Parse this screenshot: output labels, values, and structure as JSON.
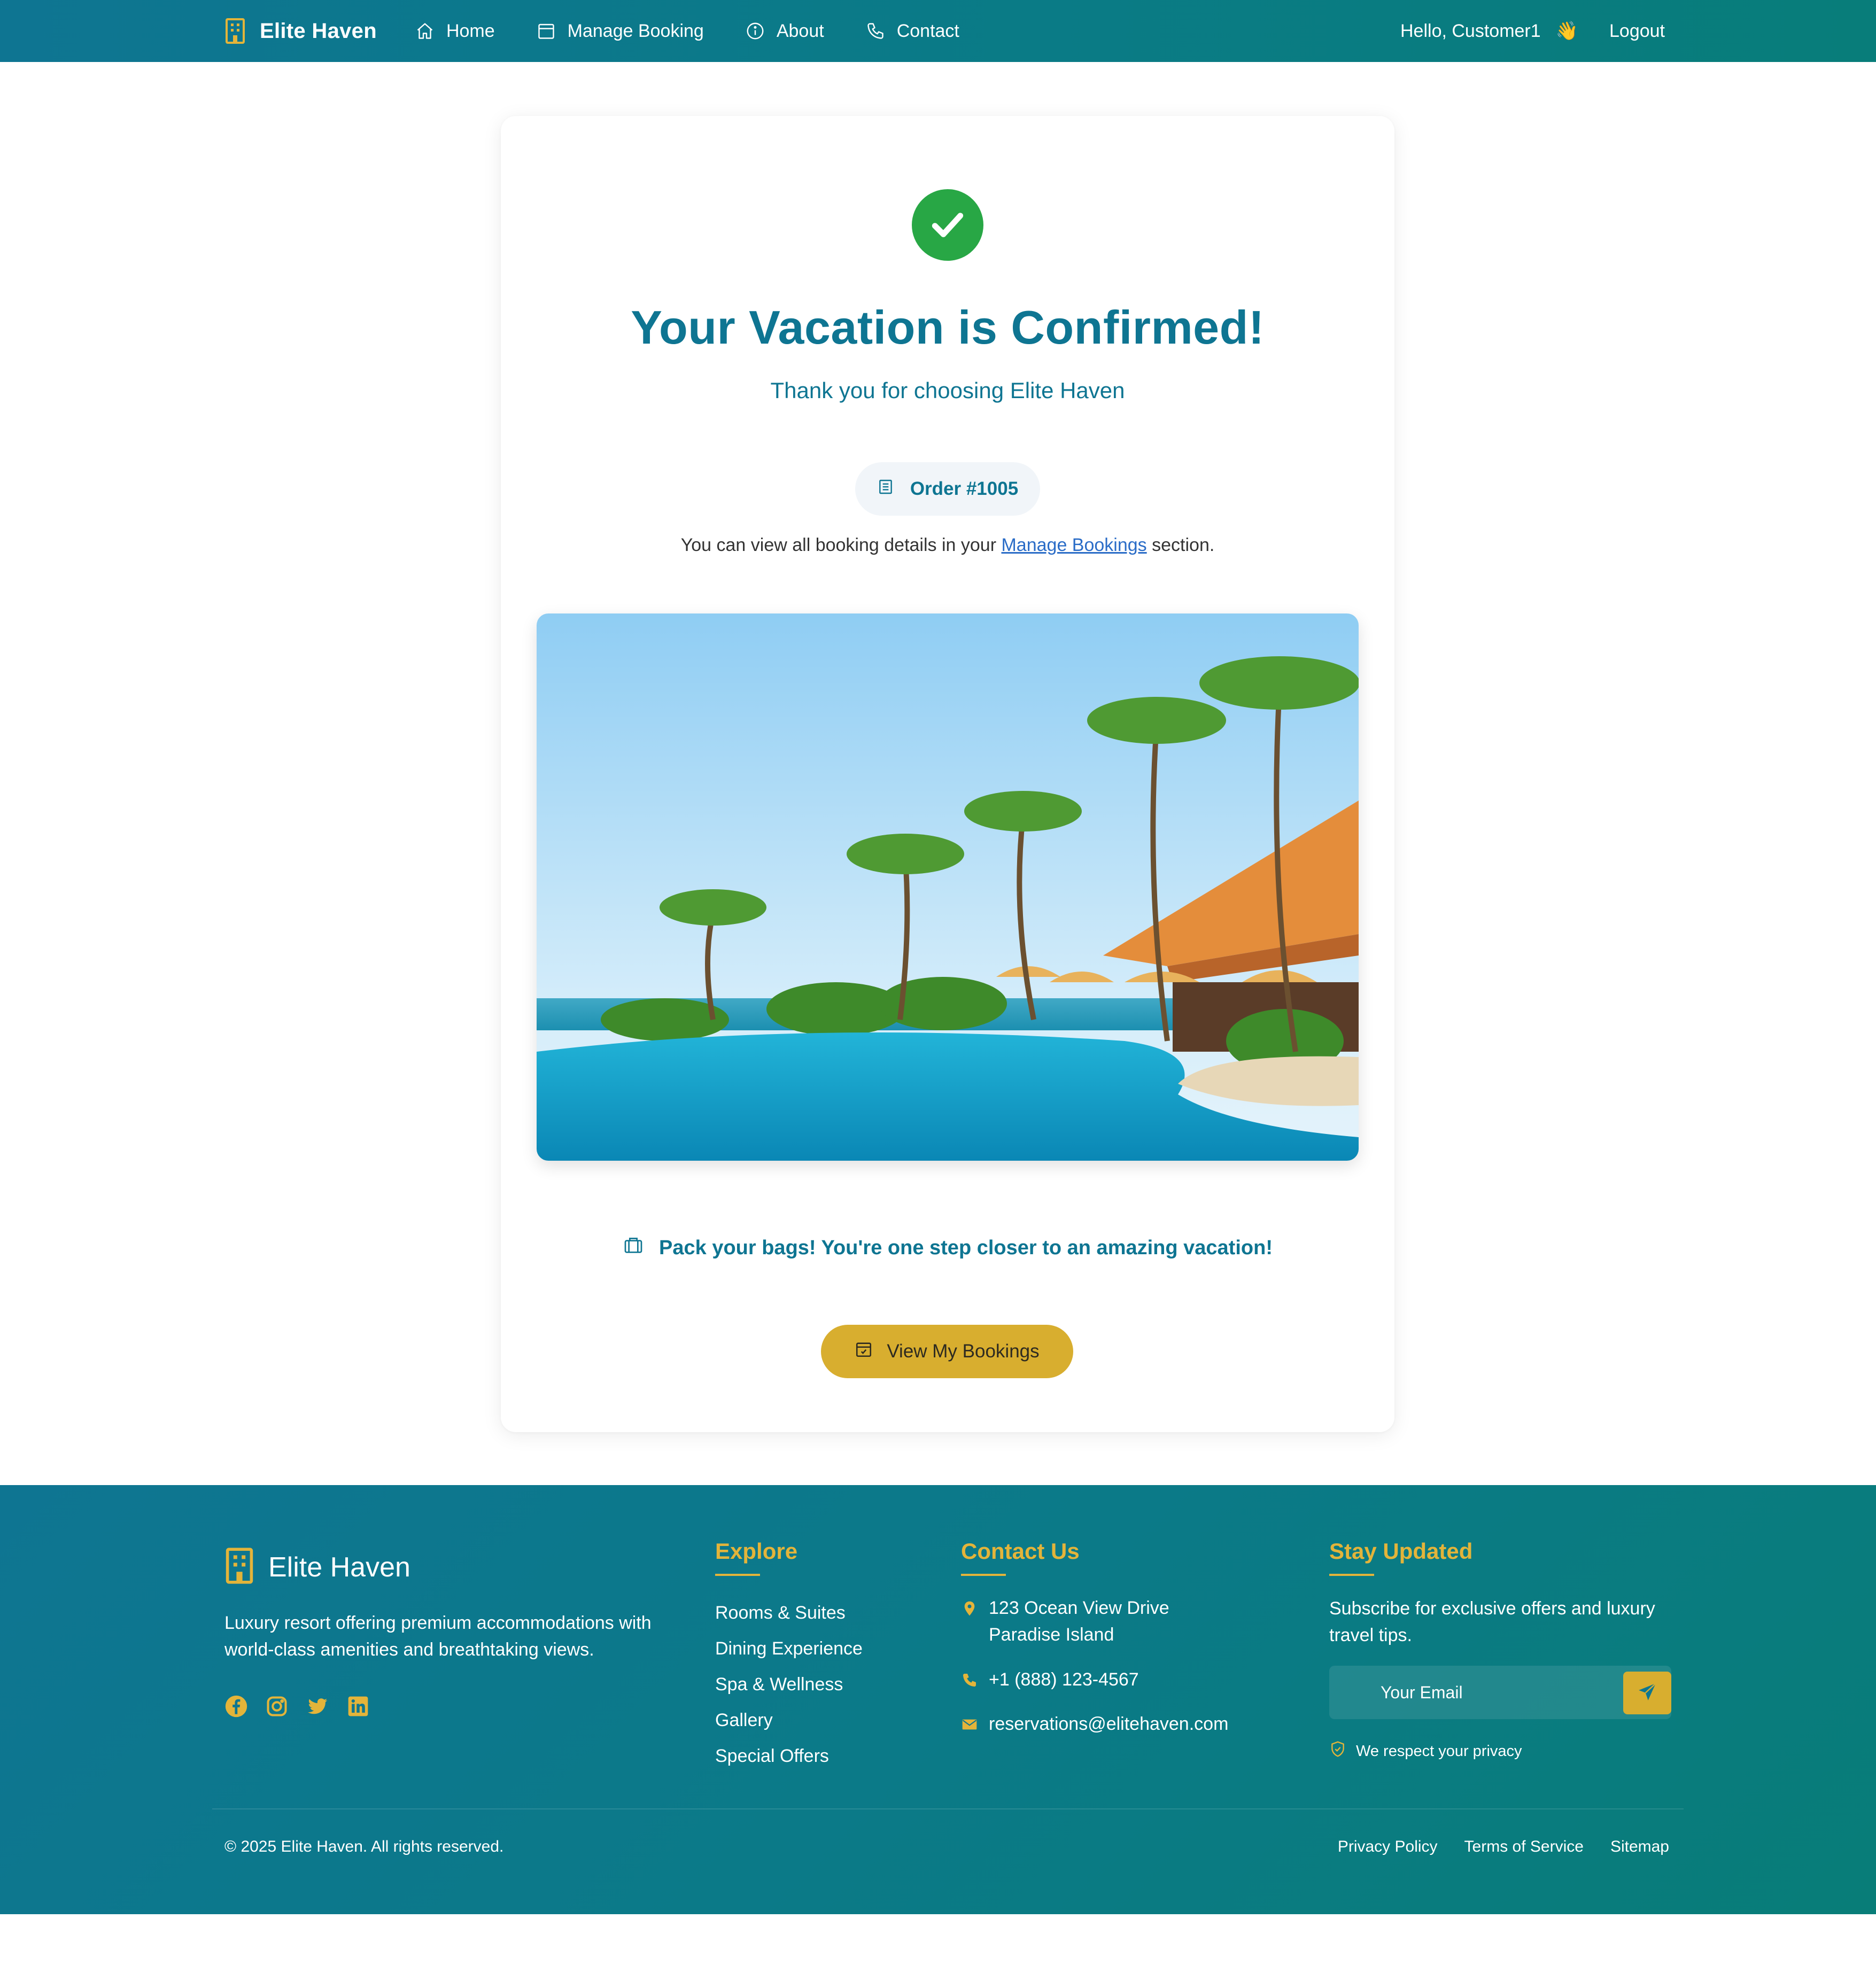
{
  "nav": {
    "brand": "Elite Haven",
    "links": [
      {
        "label": "Home"
      },
      {
        "label": "Manage Booking"
      },
      {
        "label": "About"
      },
      {
        "label": "Contact"
      }
    ],
    "greeting": "Hello, Customer1",
    "greeting_emoji": "👋",
    "logout": "Logout"
  },
  "confirmation": {
    "title": "Your Vacation is Confirmed!",
    "subtitle": "Thank you for choosing Elite Haven",
    "order": "Order #1005",
    "details_prefix": "You can view all booking details in your",
    "details_link": "Manage Bookings",
    "details_suffix": "section.",
    "pack_message": "Pack your bags! You're one step closer to an amazing vacation!",
    "button": "View My Bookings"
  },
  "footer": {
    "brand": "Elite Haven",
    "about": "Luxury resort offering premium accommodations with world-class amenities and breathtaking views.",
    "explore": {
      "title": "Explore",
      "items": [
        "Rooms & Suites",
        "Dining Experience",
        "Spa & Wellness",
        "Gallery",
        "Special Offers"
      ]
    },
    "contact": {
      "title": "Contact Us",
      "address_line1": "123 Ocean View Drive",
      "address_line2": "Paradise Island",
      "phone": "+1 (888) 123-4567",
      "email": "reservations@elitehaven.com"
    },
    "newsletter": {
      "title": "Stay Updated",
      "text": "Subscribe for exclusive offers and luxury travel tips.",
      "placeholder": "Your Email",
      "privacy": "We respect your privacy"
    },
    "copyright": "© 2025 Elite Haven. All rights reserved.",
    "legal": [
      "Privacy Policy",
      "Terms of Service",
      "Sitemap"
    ]
  },
  "colors": {
    "primary": "#0e7592",
    "accent_gold": "#d8ae2f",
    "success": "#28a745",
    "link": "#2a6cc7"
  },
  "icons": {
    "brand": "building-icon",
    "nav": [
      "home-icon",
      "calendar-icon",
      "info-icon",
      "phone-icon"
    ],
    "social": [
      "facebook-icon",
      "instagram-icon",
      "twitter-icon",
      "linkedin-icon"
    ]
  }
}
